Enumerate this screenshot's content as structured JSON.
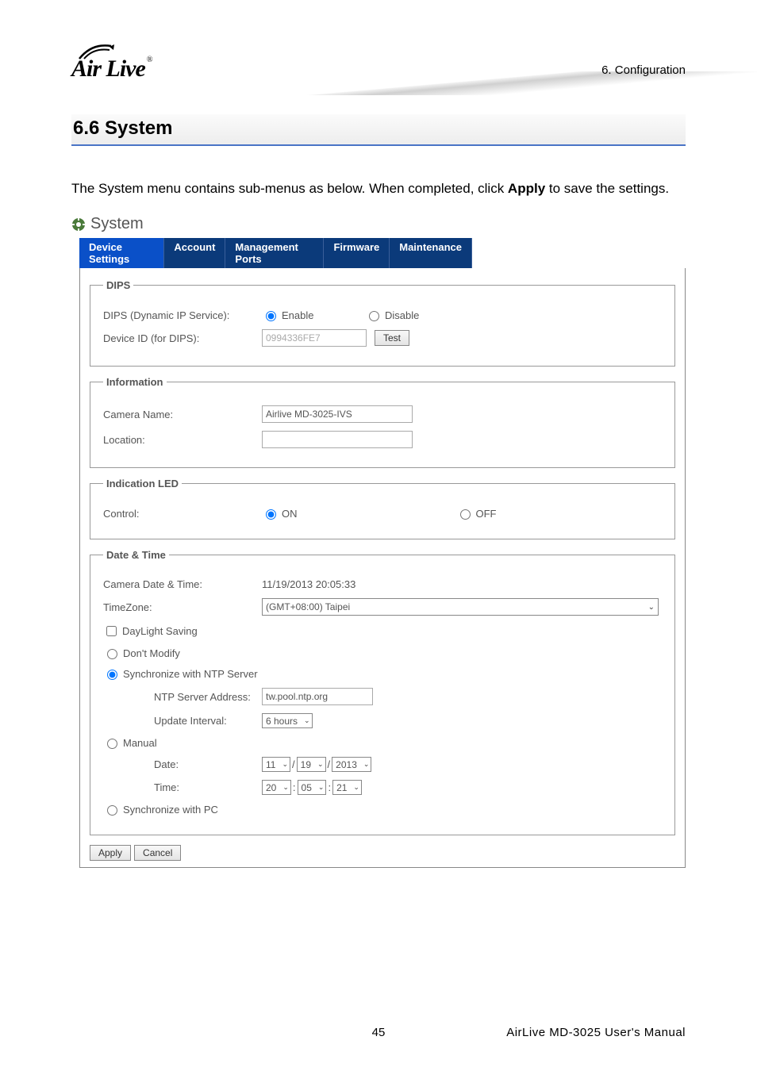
{
  "header": {
    "logo_text": "Air Live",
    "chapter": "6.  Configuration"
  },
  "section": {
    "number_title": "6.6 System",
    "intro_pre": "The System menu contains sub-menus as below. When completed, click ",
    "intro_bold": "Apply",
    "intro_post": " to save the settings."
  },
  "system": {
    "title": "System",
    "tabs": [
      "Device Settings",
      "Account",
      "Management Ports",
      "Firmware",
      "Maintenance"
    ],
    "active_tab": 0
  },
  "dips": {
    "legend": "DIPS",
    "service_label": "DIPS (Dynamic IP Service):",
    "enable_label": "Enable",
    "disable_label": "Disable",
    "service_value": "enable",
    "device_id_label": "Device ID (for DIPS):",
    "device_id_value": "0994336FE7",
    "test_label": "Test"
  },
  "info": {
    "legend": "Information",
    "camera_name_label": "Camera Name:",
    "camera_name_value": "Airlive MD-3025-IVS",
    "location_label": "Location:",
    "location_value": ""
  },
  "led": {
    "legend": "Indication LED",
    "control_label": "Control:",
    "on_label": "ON",
    "off_label": "OFF",
    "value": "on"
  },
  "datetime": {
    "legend": "Date & Time",
    "camera_dt_label": "Camera Date & Time:",
    "camera_dt_value": "11/19/2013 20:05:33",
    "tz_label": "TimeZone:",
    "tz_value": "(GMT+08:00) Taipei",
    "daylight_label": "DayLight Saving",
    "daylight_checked": false,
    "mode": "ntp",
    "dont_modify_label": "Don't Modify",
    "sync_ntp_label": "Synchronize with NTP Server",
    "ntp_addr_label": "NTP Server Address:",
    "ntp_addr_value": "tw.pool.ntp.org",
    "update_interval_label": "Update Interval:",
    "update_interval_value": "6 hours",
    "manual_label": "Manual",
    "date_label": "Date:",
    "date_m": "11",
    "date_d": "19",
    "date_y": "2013",
    "time_label": "Time:",
    "time_h": "20",
    "time_mi": "05",
    "time_s": "21",
    "sync_pc_label": "Synchronize with PC"
  },
  "buttons": {
    "apply": "Apply",
    "cancel": "Cancel"
  },
  "footer": {
    "page_number": "45",
    "doc_title": "AirLive  MD-3025  User's  Manual"
  }
}
